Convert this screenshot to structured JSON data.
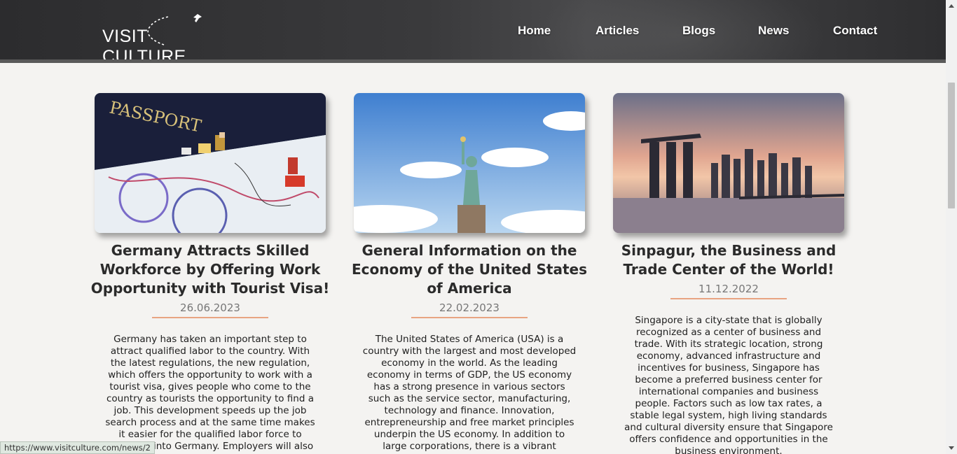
{
  "header": {
    "logo_text": "VISIT CULTURE",
    "nav": [
      {
        "label": "Home"
      },
      {
        "label": "Articles"
      },
      {
        "label": "Blogs"
      },
      {
        "label": "News"
      },
      {
        "label": "Contact"
      }
    ]
  },
  "articles": [
    {
      "title": "Germany Attracts Skilled Workforce by Offering Work Opportunity with Tourist Visa!",
      "date": "26.06.2023",
      "image": "passport-with-miniature-travelers",
      "excerpt": "Germany has taken an important step to attract qualified labor to the country. With the latest regulations, the new regulation, which offers the opportunity to work with a tourist visa, gives people who come to the country as tourists the opportunity to find a job. This development speeds up the job search process and at the same time makes it easier for the qualified labor force to integrate into Germany. Employers will also be able to"
    },
    {
      "title": "General Information on the Economy of the United States of America",
      "date": "22.02.2023",
      "image": "statue-of-liberty",
      "excerpt": "The United States of America (USA) is a country with the largest and most developed economy in the world. As the leading economy in terms of GDP, the US economy has a strong presence in various sectors such as the service sector, manufacturing, technology and finance. Innovation, entrepreneurship and free market principles underpin the US economy. In addition to large corporations, there is a vibrant business"
    },
    {
      "title": "Sinpagur, the Business and Trade Center of the World!",
      "date": "11.12.2022",
      "image": "singapore-skyline-at-dusk",
      "excerpt": "Singapore is a city-state that is globally recognized as a center of business and trade. With its strategic location, strong economy, advanced infrastructure and incentives for business, Singapore has become a preferred business center for international companies and business people. Factors such as low tax rates, a stable legal system, high living standards and cultural diversity ensure that Singapore offers confidence and opportunities in the business environment."
    }
  ],
  "status_bar": {
    "url": "https://www.visitculture.com/news/2"
  },
  "colors": {
    "accent_rule": "#e8a482",
    "header_bg": "#2c2c2e",
    "page_bg": "#f4f3f1"
  }
}
